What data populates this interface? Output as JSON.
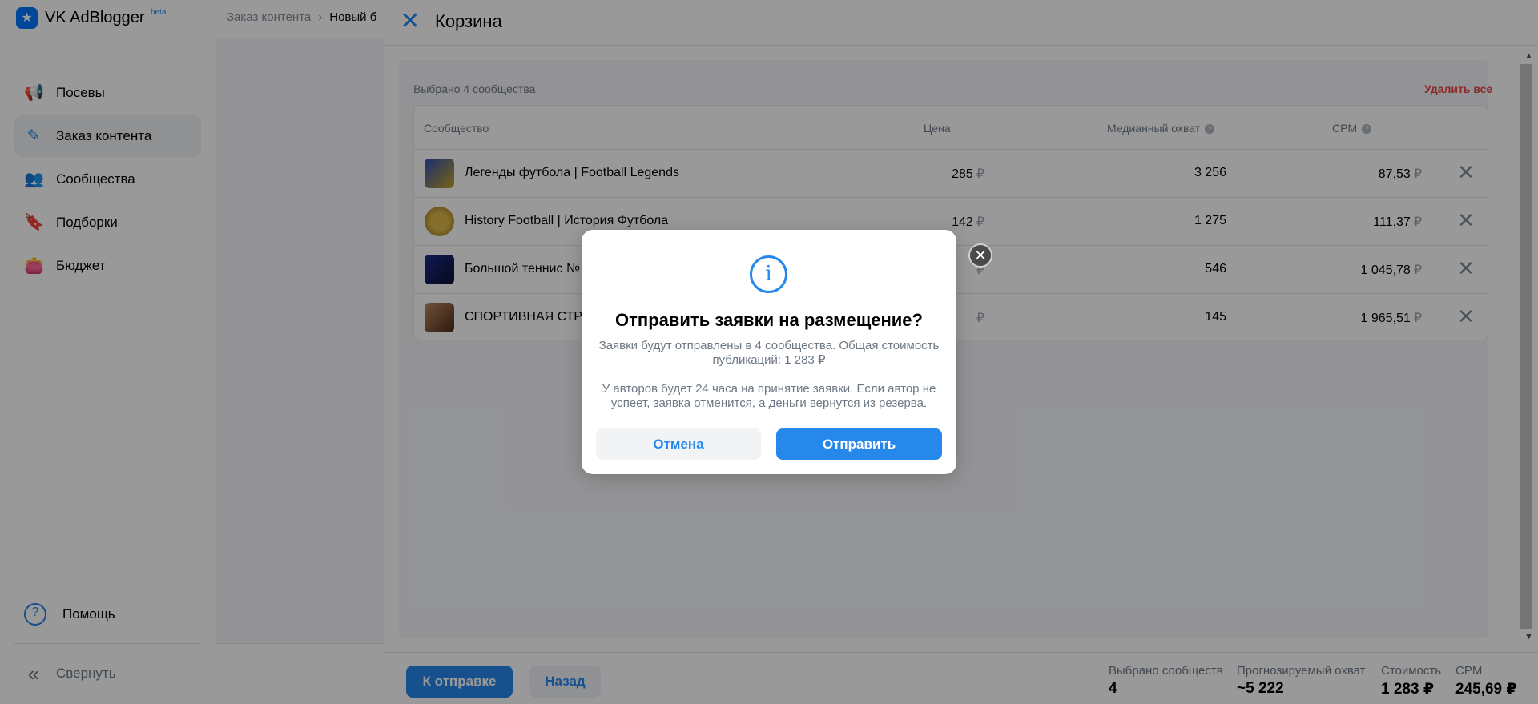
{
  "app": {
    "title": "VK AdBlogger",
    "beta": "beta",
    "logo_glyph": "★"
  },
  "breadcrumb": {
    "parent": "Заказ контента",
    "separator": "›",
    "current": "Новый б"
  },
  "sidebar": {
    "items": [
      {
        "label": "Посевы",
        "icon": "megaphone-icon",
        "glyph": "📢"
      },
      {
        "label": "Заказ контента",
        "icon": "edit-list-icon",
        "glyph": "✎",
        "active": true
      },
      {
        "label": "Сообщества",
        "icon": "users-icon",
        "glyph": "👥"
      },
      {
        "label": "Подборки",
        "icon": "bookmark-icon",
        "glyph": "🔖"
      },
      {
        "label": "Бюджет",
        "icon": "wallet-icon",
        "glyph": "👛"
      }
    ],
    "help": {
      "label": "Помощь",
      "glyph": "?"
    },
    "collapse": {
      "label": "Свернуть",
      "glyph": "«"
    }
  },
  "drawer": {
    "close_glyph": "✕",
    "title": "Корзина",
    "selected_count": "Выбрано 4 сообщества",
    "delete_all": "Удалить все",
    "columns": {
      "community": "Сообщество",
      "price": "Цена",
      "median_reach": "Медианный охват",
      "cpm": "CPM",
      "help_glyph": "?"
    },
    "currency": "₽",
    "remove_glyph": "✕",
    "rows": [
      {
        "name": "Легенды футбола | Football Legends",
        "price": "285",
        "reach": "3 256",
        "cpm": "87,53",
        "avatar_color": "#2a4fb8"
      },
      {
        "name": "History Football | История Футбола",
        "price": "142",
        "reach": "1 275",
        "cpm": "111,37",
        "avatar_color": "#c9a227"
      },
      {
        "name": "Большой теннис №",
        "price": "",
        "reach": "546",
        "cpm": "1 045,78",
        "avatar_color": "#1b2a8a"
      },
      {
        "name": "СПОРТИВНАЯ СТРА",
        "price": "",
        "reach": "145",
        "cpm": "1 965,51",
        "avatar_color": "#7a4a2e"
      }
    ],
    "footer": {
      "send_button": "К отправке",
      "back_button": "Назад",
      "stats": [
        {
          "label": "Выбрано сообществ",
          "value": "4"
        },
        {
          "label": "Прогнозируемый охват",
          "value": "~5 222"
        },
        {
          "label": "Стоимость",
          "value": "1 283 ₽"
        },
        {
          "label": "CPM",
          "value": "245,69 ₽"
        }
      ]
    }
  },
  "modal": {
    "info_glyph": "i",
    "title": "Отправить заявки на размещение?",
    "text1": "Заявки будут отправлены в 4 сообщества. Общая стоимость публикаций: 1 283 ₽",
    "text2": "У авторов будет 24 часа на принятие заявки. Если автор не успеет, заявка отменится, а деньги вернутся из резерва.",
    "cancel_button": "Отмена",
    "send_button": "Отправить",
    "close_glyph": "✕"
  },
  "colors": {
    "accent": "#2688eb",
    "danger": "#e64646",
    "overlay": "rgba(0,0,0,0.4)"
  }
}
